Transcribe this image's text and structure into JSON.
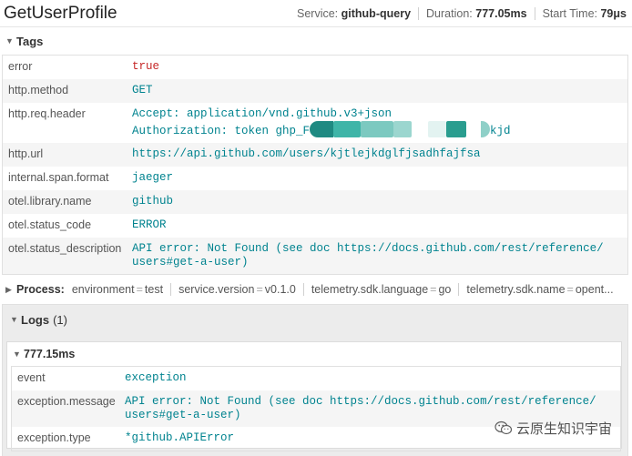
{
  "header": {
    "title": "GetUserProfile",
    "service_label": "Service:",
    "service_value": "github-query",
    "duration_label": "Duration:",
    "duration_value": "777.05ms",
    "start_label": "Start Time:",
    "start_value": "79μs"
  },
  "tags": {
    "label": "Tags",
    "rows": [
      {
        "key": "error",
        "value": "true",
        "status": "error"
      },
      {
        "key": "http.method",
        "value": "GET"
      },
      {
        "key": "http.req.header",
        "value_line1": "Accept: application/vnd.github.v3+json",
        "value_line2_prefix": "Authorization: token ghp_F",
        "value_line2_suffix": "kjd"
      },
      {
        "key": "http.url",
        "value": "https://api.github.com/users/kjtlejkdglfjsadhfajfsa"
      },
      {
        "key": "internal.span.format",
        "value": "jaeger"
      },
      {
        "key": "otel.library.name",
        "value": "github"
      },
      {
        "key": "otel.status_code",
        "value": "ERROR"
      },
      {
        "key": "otel.status_description",
        "value": "API error: Not Found (see doc https://docs.github.com/rest/reference/\nusers#get-a-user)"
      }
    ]
  },
  "process": {
    "label": "Process:",
    "items": [
      {
        "key": "environment",
        "value": "test"
      },
      {
        "key": "service.version",
        "value": "v0.1.0"
      },
      {
        "key": "telemetry.sdk.language",
        "value": "go"
      },
      {
        "key": "telemetry.sdk.name",
        "value": "opent..."
      }
    ]
  },
  "logs": {
    "label": "Logs",
    "count": "(1)",
    "entries": [
      {
        "time": "777.15ms",
        "fields": [
          {
            "key": "event",
            "value": "exception"
          },
          {
            "key": "exception.message",
            "value": "API error: Not Found (see doc https://docs.github.com/rest/reference/\nusers#get-a-user)"
          },
          {
            "key": "exception.type",
            "value": "*github.APIError"
          }
        ]
      }
    ]
  },
  "watermark": {
    "text": "云原生知识宇宙",
    "icon": "wechat-icon"
  },
  "colors": {
    "value_teal": "#00838f",
    "error_red": "#c62828",
    "redaction": [
      "#2a9d8f",
      "#3fb5a8",
      "#7cc9c0",
      "#1f8a82"
    ]
  }
}
